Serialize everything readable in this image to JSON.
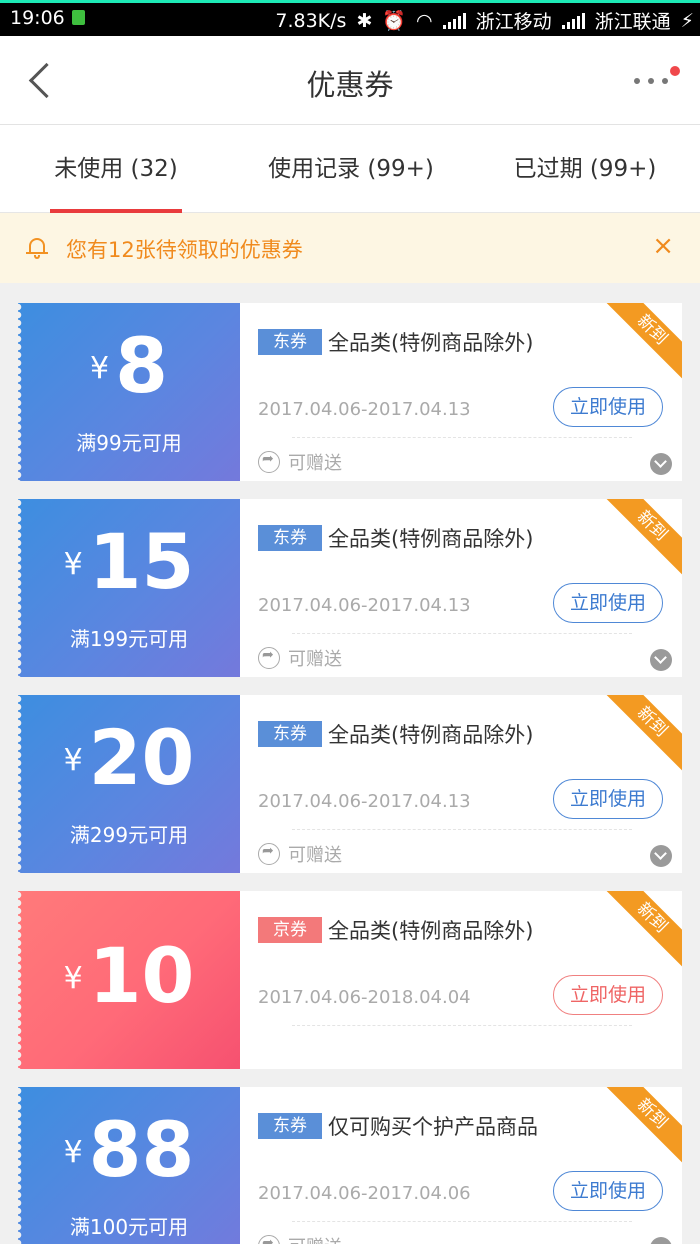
{
  "status_bar": {
    "time": "19:06",
    "speed": "7.83K/s",
    "carrier1": "浙江移动",
    "carrier2": "浙江联通"
  },
  "nav": {
    "title": "优惠券"
  },
  "tabs": [
    {
      "label": "未使用 (32)",
      "active": true
    },
    {
      "label": "使用记录 (99+)",
      "active": false
    },
    {
      "label": "已过期 (99+)",
      "active": false
    }
  ],
  "notice": {
    "text": "您有12张待领取的优惠券",
    "close": "×"
  },
  "coupons": [
    {
      "theme": "blue",
      "currency": "¥",
      "amount": "8",
      "condition": "满99元可用",
      "tag": "东券",
      "scope": "全品类(特例商品除外)",
      "date": "2017.04.06-2017.04.13",
      "button": "立即使用",
      "gift": "可赠送",
      "ribbon": "新到"
    },
    {
      "theme": "blue",
      "currency": "¥",
      "amount": "15",
      "condition": "满199元可用",
      "tag": "东券",
      "scope": "全品类(特例商品除外)",
      "date": "2017.04.06-2017.04.13",
      "button": "立即使用",
      "gift": "可赠送",
      "ribbon": "新到"
    },
    {
      "theme": "blue",
      "currency": "¥",
      "amount": "20",
      "condition": "满299元可用",
      "tag": "东券",
      "scope": "全品类(特例商品除外)",
      "date": "2017.04.06-2017.04.13",
      "button": "立即使用",
      "gift": "可赠送",
      "ribbon": "新到"
    },
    {
      "theme": "red",
      "currency": "¥",
      "amount": "10",
      "tag": "京券",
      "scope": "全品类(特例商品除外)",
      "date": "2017.04.06-2018.04.04",
      "button": "立即使用",
      "ribbon": "新到"
    },
    {
      "theme": "blue",
      "currency": "¥",
      "amount": "88",
      "condition": "满100元可用",
      "tag": "东券",
      "scope": "仅可购买个护产品商品",
      "date": "2017.04.06-2017.04.06",
      "button": "立即使用",
      "gift": "可赠送",
      "ribbon": "新到"
    }
  ],
  "colors": {
    "accent_red": "#e93b3d",
    "notice_orange": "#f08a1d",
    "blue": "#4f88d6",
    "pink": "#f3797a",
    "ribbon": "#f39a22"
  }
}
